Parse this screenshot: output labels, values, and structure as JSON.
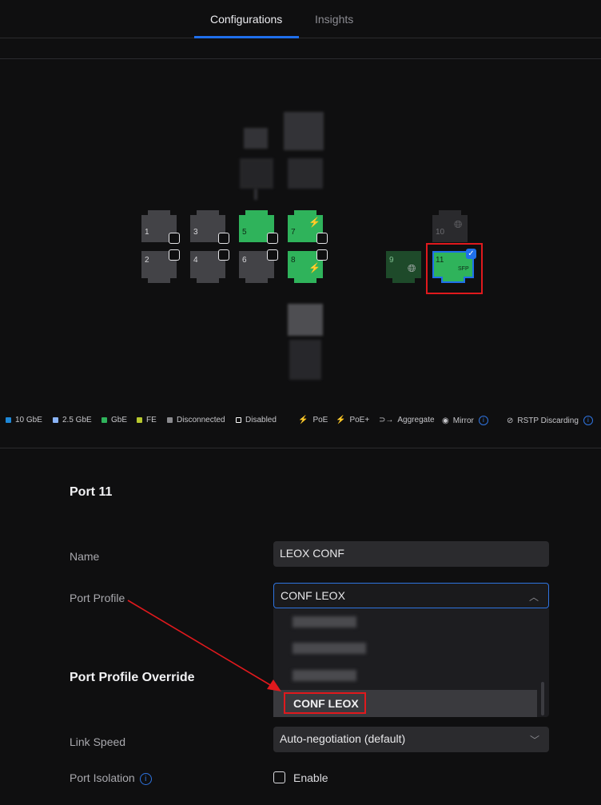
{
  "tabs": [
    {
      "label": "Configurations",
      "active": true
    },
    {
      "label": "Insights",
      "active": false
    }
  ],
  "ports": [
    {
      "number": "1",
      "status": "Disconnected"
    },
    {
      "number": "2",
      "status": "Disconnected"
    },
    {
      "number": "3",
      "status": "Disconnected"
    },
    {
      "number": "4",
      "status": "Disconnected"
    },
    {
      "number": "5",
      "status": "GbE"
    },
    {
      "number": "6",
      "status": "Disconnected"
    },
    {
      "number": "7",
      "status": "GbE",
      "poe": "PoE+"
    },
    {
      "number": "8",
      "status": "GbE",
      "poe": "PoE+"
    },
    {
      "number": "9",
      "status": "GbE"
    },
    {
      "number": "10",
      "status": "Disconnected"
    },
    {
      "number": "11",
      "status": "GbE",
      "badge": "SFP",
      "selected": true
    }
  ],
  "legend": [
    {
      "label": "10 GbE",
      "color": "#1e88d8"
    },
    {
      "label": "2.5 GbE",
      "color": "#8ab4f8"
    },
    {
      "label": "GbE",
      "color": "#2fb35b"
    },
    {
      "label": "FE",
      "color": "#b8c92e"
    },
    {
      "label": "Disconnected",
      "color": "#8a8a8e"
    },
    {
      "label": "Disabled",
      "color": "#ffffff"
    },
    {
      "label": "PoE",
      "icon": "bolt-icon"
    },
    {
      "label": "PoE+",
      "icon": "bolt-plus-icon"
    },
    {
      "label": "Aggregate",
      "icon": "aggregate-icon"
    },
    {
      "label": "Mirror",
      "icon": "eye-icon"
    },
    {
      "label": "RSTP Discarding",
      "icon": "block-icon"
    }
  ],
  "port_panel": {
    "title": "Port 11",
    "name_label": "Name",
    "name_value": "LEOX CONF",
    "profile_label": "Port Profile",
    "profile_value": "CONF LEOX",
    "dropdown_selected": "CONF LEOX",
    "override_title": "Port Profile Override",
    "link_speed_label": "Link Speed",
    "link_speed_value": "Auto-negotiation (default)",
    "isolation_label": "Port Isolation",
    "isolation_option": "Enable"
  }
}
